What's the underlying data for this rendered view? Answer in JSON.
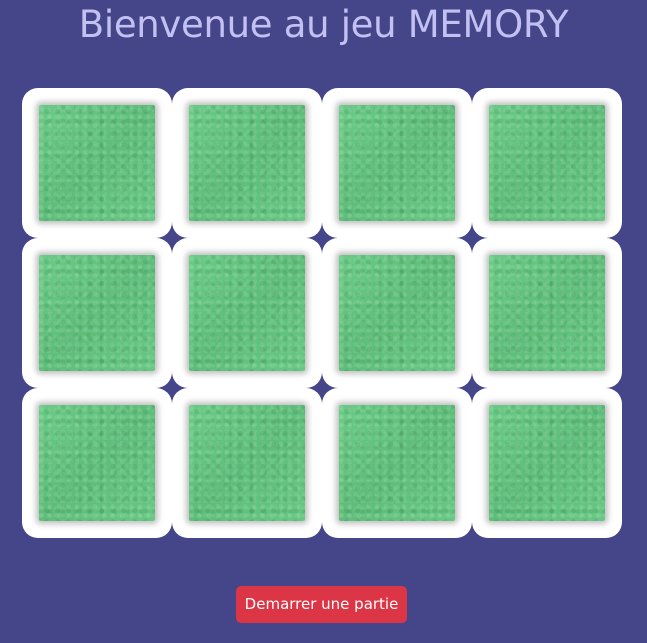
{
  "header": {
    "title": "Bienvenue au jeu MEMORY"
  },
  "board": {
    "rows": 3,
    "columns": 4,
    "card_face": "face-down",
    "card_back_color": "#62c47e",
    "card_frame_color": "#ffffff"
  },
  "controls": {
    "start_label": "Demarrer une partie",
    "start_color": "#dc3545"
  },
  "theme": {
    "background": "#45458a",
    "title_color": "#c3c0f2"
  }
}
